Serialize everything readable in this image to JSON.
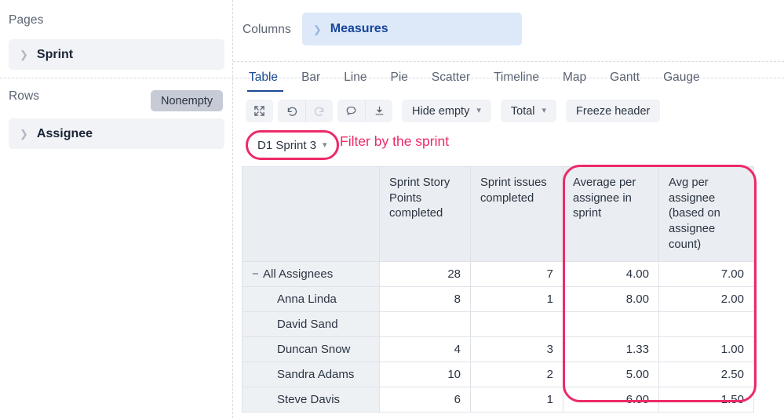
{
  "left_panel": {
    "pages_label": "Pages",
    "pages_chip": "Sprint",
    "rows_label": "Rows",
    "rows_badge": "Nonempty",
    "rows_chip": "Assignee"
  },
  "columns_shelf": {
    "label": "Columns",
    "chip": "Measures"
  },
  "tabs": [
    {
      "label": "Table",
      "active": true
    },
    {
      "label": "Bar",
      "active": false
    },
    {
      "label": "Line",
      "active": false
    },
    {
      "label": "Pie",
      "active": false
    },
    {
      "label": "Scatter",
      "active": false
    },
    {
      "label": "Timeline",
      "active": false
    },
    {
      "label": "Map",
      "active": false
    },
    {
      "label": "Gantt",
      "active": false
    },
    {
      "label": "Gauge",
      "active": false
    }
  ],
  "toolbar": {
    "icons": [
      {
        "name": "expand-icon",
        "glyph": "expand"
      },
      {
        "name": "undo-icon",
        "glyph": "undo"
      },
      {
        "name": "redo-icon",
        "glyph": "redo",
        "disabled": true
      },
      {
        "name": "comment-icon",
        "glyph": "comment"
      },
      {
        "name": "download-icon",
        "glyph": "download"
      }
    ],
    "hide_empty": "Hide empty",
    "total": "Total",
    "freeze_header": "Freeze header"
  },
  "sprint_filter": {
    "value": "D1 Sprint 3"
  },
  "annotations": {
    "filter_note": "Filter by the sprint",
    "accent_color": "#ec2a67"
  },
  "table": {
    "corner_header": "",
    "columns": [
      "Sprint Story Points completed",
      "Sprint issues completed",
      "Average per assignee in sprint",
      "Avg per assignee (based on assignee count)"
    ],
    "rows": [
      {
        "label": "All Assignees",
        "level": 0,
        "toggle": "−",
        "values": [
          "28",
          "7",
          "4.00",
          "7.00"
        ]
      },
      {
        "label": "Anna Linda",
        "level": 1,
        "toggle": "",
        "values": [
          "8",
          "1",
          "8.00",
          "2.00"
        ]
      },
      {
        "label": "David Sand",
        "level": 1,
        "toggle": "",
        "values": [
          "",
          "",
          "",
          ""
        ]
      },
      {
        "label": "Duncan Snow",
        "level": 1,
        "toggle": "",
        "values": [
          "4",
          "3",
          "1.33",
          "1.00"
        ]
      },
      {
        "label": "Sandra Adams",
        "level": 1,
        "toggle": "",
        "values": [
          "10",
          "2",
          "5.00",
          "2.50"
        ]
      },
      {
        "label": "Steve Davis",
        "level": 1,
        "toggle": "",
        "values": [
          "6",
          "1",
          "6.00",
          "1.50"
        ]
      }
    ]
  }
}
